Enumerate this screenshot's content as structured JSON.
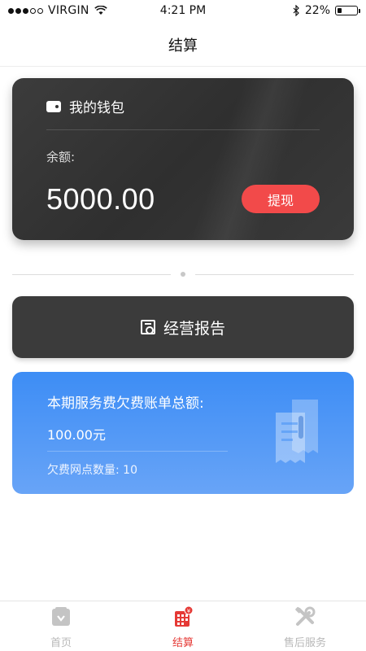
{
  "status_bar": {
    "carrier": "VIRGIN",
    "time": "4:21 PM",
    "battery": "22%",
    "battery_level": 0.22
  },
  "nav": {
    "title": "结算"
  },
  "wallet": {
    "title": "我的钱包",
    "balance_label": "余额:",
    "balance": "5000.00",
    "withdraw_label": "提现"
  },
  "report": {
    "label": "经营报告"
  },
  "bill": {
    "title": "本期服务费欠费账单总额:",
    "amount": "100.00元",
    "count_text": "欠费网点数量: 10"
  },
  "tabs": [
    {
      "label": "首页",
      "icon": "home-bag-icon",
      "active": false
    },
    {
      "label": "结算",
      "icon": "settlement-icon",
      "active": true
    },
    {
      "label": "售后服务",
      "icon": "tools-icon",
      "active": false
    }
  ],
  "colors": {
    "accent_red": "#f24a4a",
    "tab_active": "#e53935",
    "card_dark": "#3b3b3b",
    "bill_blue": "#3d8df5"
  }
}
